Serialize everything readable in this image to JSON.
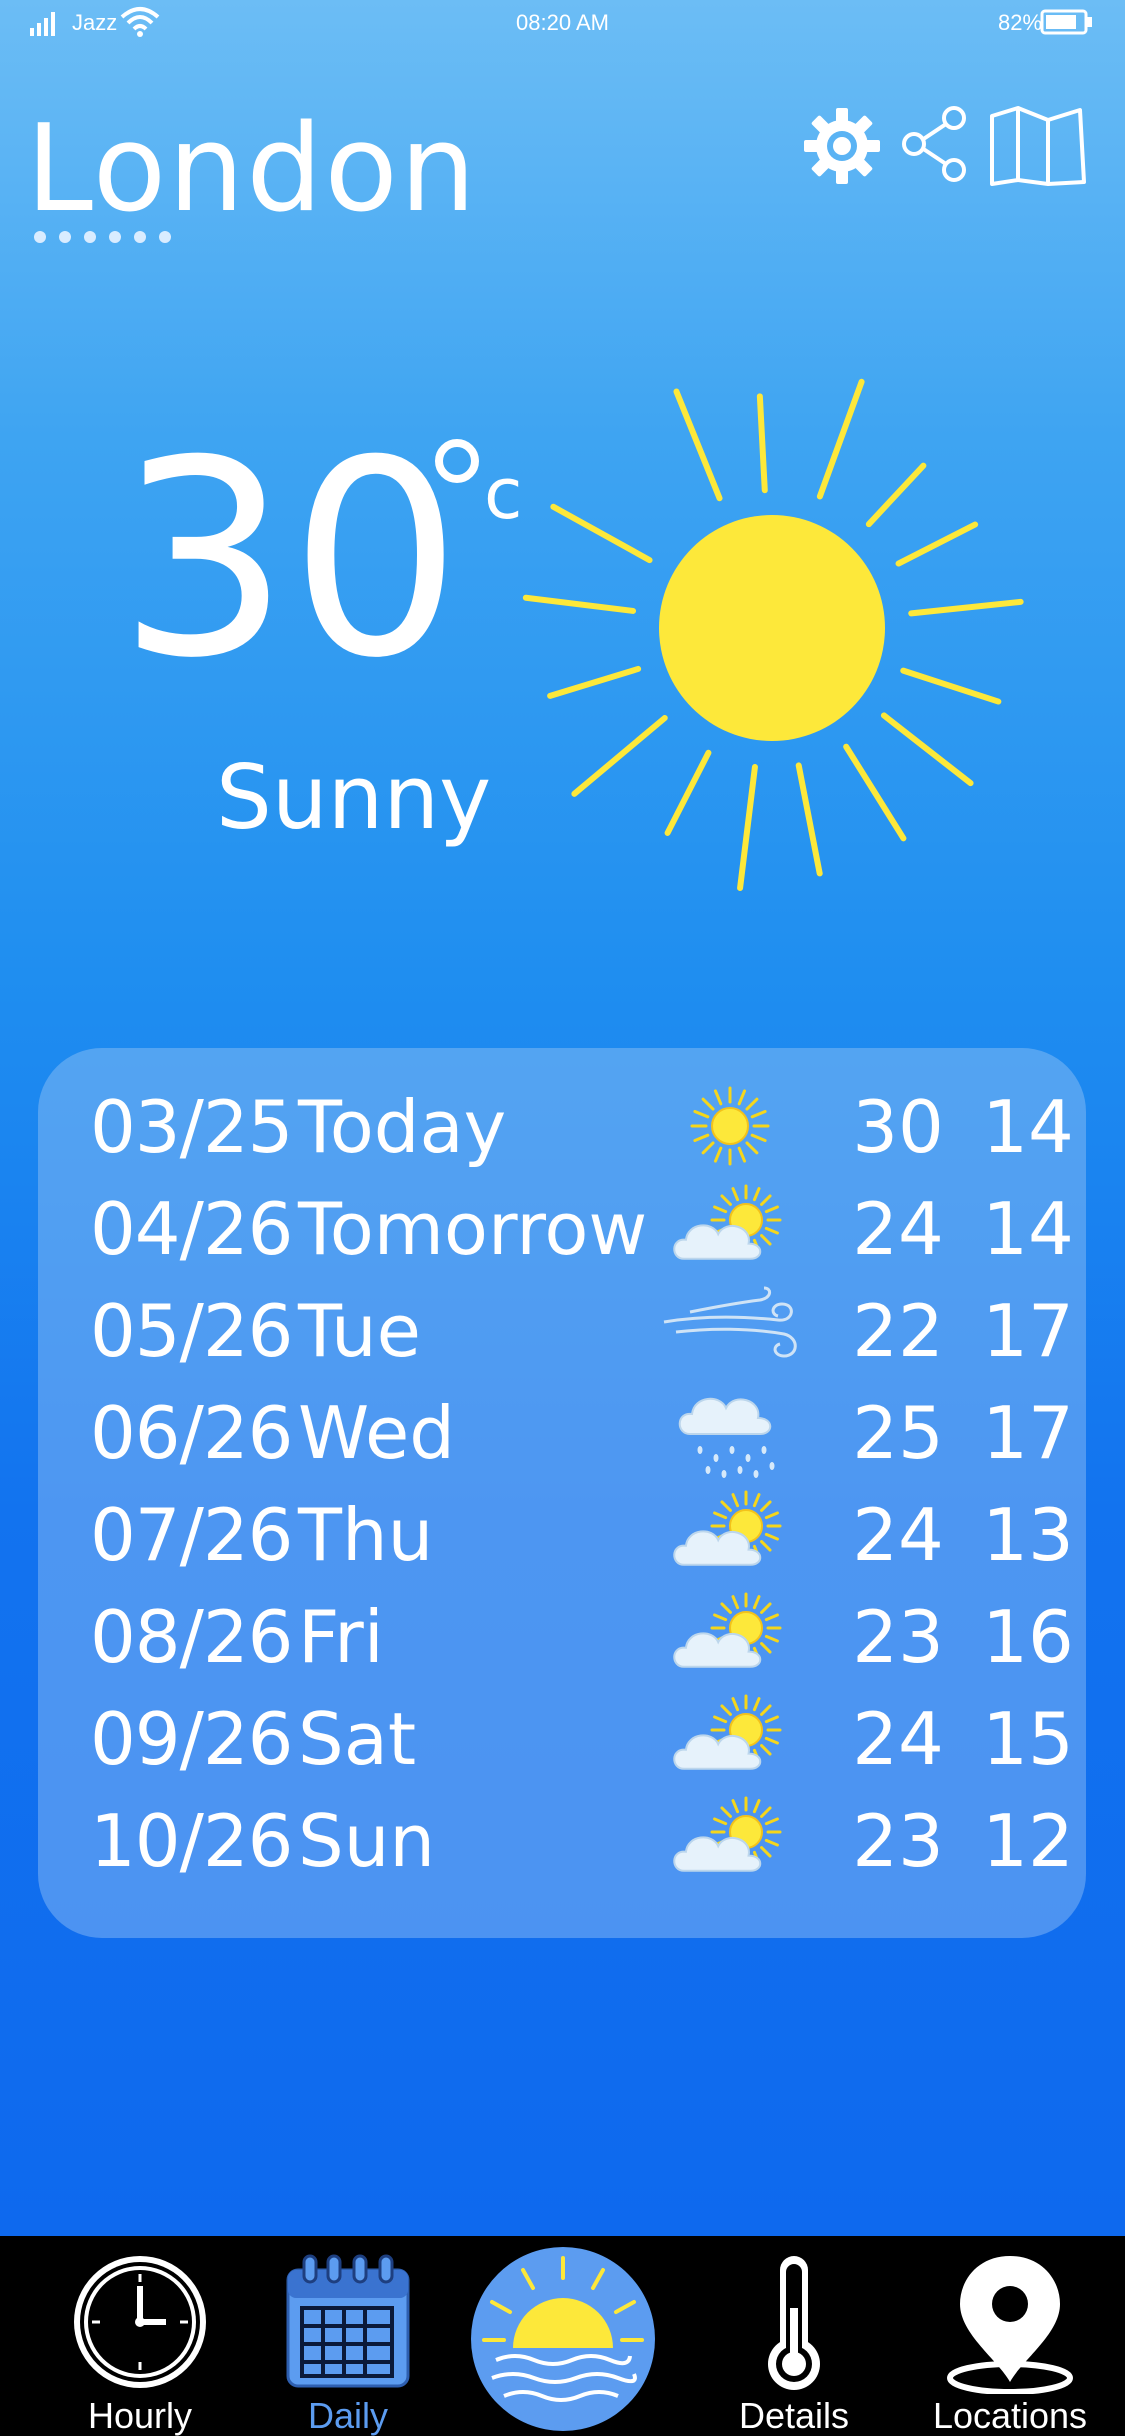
{
  "status_bar": {
    "carrier": "Jazz",
    "time": "08:20 AM",
    "battery": "82%",
    "icons": [
      "signal-icon",
      "wifi-icon",
      "battery-icon"
    ]
  },
  "header": {
    "city": "London",
    "page_indicator_count": 6,
    "actions": [
      "gear-icon",
      "share-icon",
      "map-icon"
    ]
  },
  "current": {
    "temperature": "30",
    "unit": "c",
    "condition": "Sunny",
    "icon": "sun-icon"
  },
  "forecast": [
    {
      "date": "03/25",
      "day": "Today",
      "icon": "sun-icon",
      "high": "30",
      "low": "14"
    },
    {
      "date": "04/26",
      "day": "Tomorrow",
      "icon": "partly-cloudy-icon",
      "high": "24",
      "low": "14"
    },
    {
      "date": "05/26",
      "day": "Tue",
      "icon": "wind-icon",
      "high": "22",
      "low": "17"
    },
    {
      "date": "06/26",
      "day": "Wed",
      "icon": "rain-cloud-icon",
      "high": "25",
      "low": "17"
    },
    {
      "date": "07/26",
      "day": "Thu",
      "icon": "partly-cloudy-icon",
      "high": "24",
      "low": "13"
    },
    {
      "date": "08/26",
      "day": "Fri",
      "icon": "partly-cloudy-icon",
      "high": "23",
      "low": "16"
    },
    {
      "date": "09/26",
      "day": "Sat",
      "icon": "partly-cloudy-icon",
      "high": "24",
      "low": "15"
    },
    {
      "date": "10/26",
      "day": "Sun",
      "icon": "partly-cloudy-icon",
      "high": "23",
      "low": "12"
    }
  ],
  "nav": {
    "items": [
      {
        "label": "Hourly",
        "icon": "clock-icon"
      },
      {
        "label": "Daily",
        "icon": "calendar-icon",
        "active": true
      },
      {
        "label": "",
        "icon": "sunrise-icon"
      },
      {
        "label": "Details",
        "icon": "thermometer-icon"
      },
      {
        "label": "Locations",
        "icon": "location-pin-icon"
      }
    ]
  },
  "colors": {
    "sun": "#fde83a",
    "active_nav": "#5c9cf0",
    "nav_background": "#000000"
  }
}
